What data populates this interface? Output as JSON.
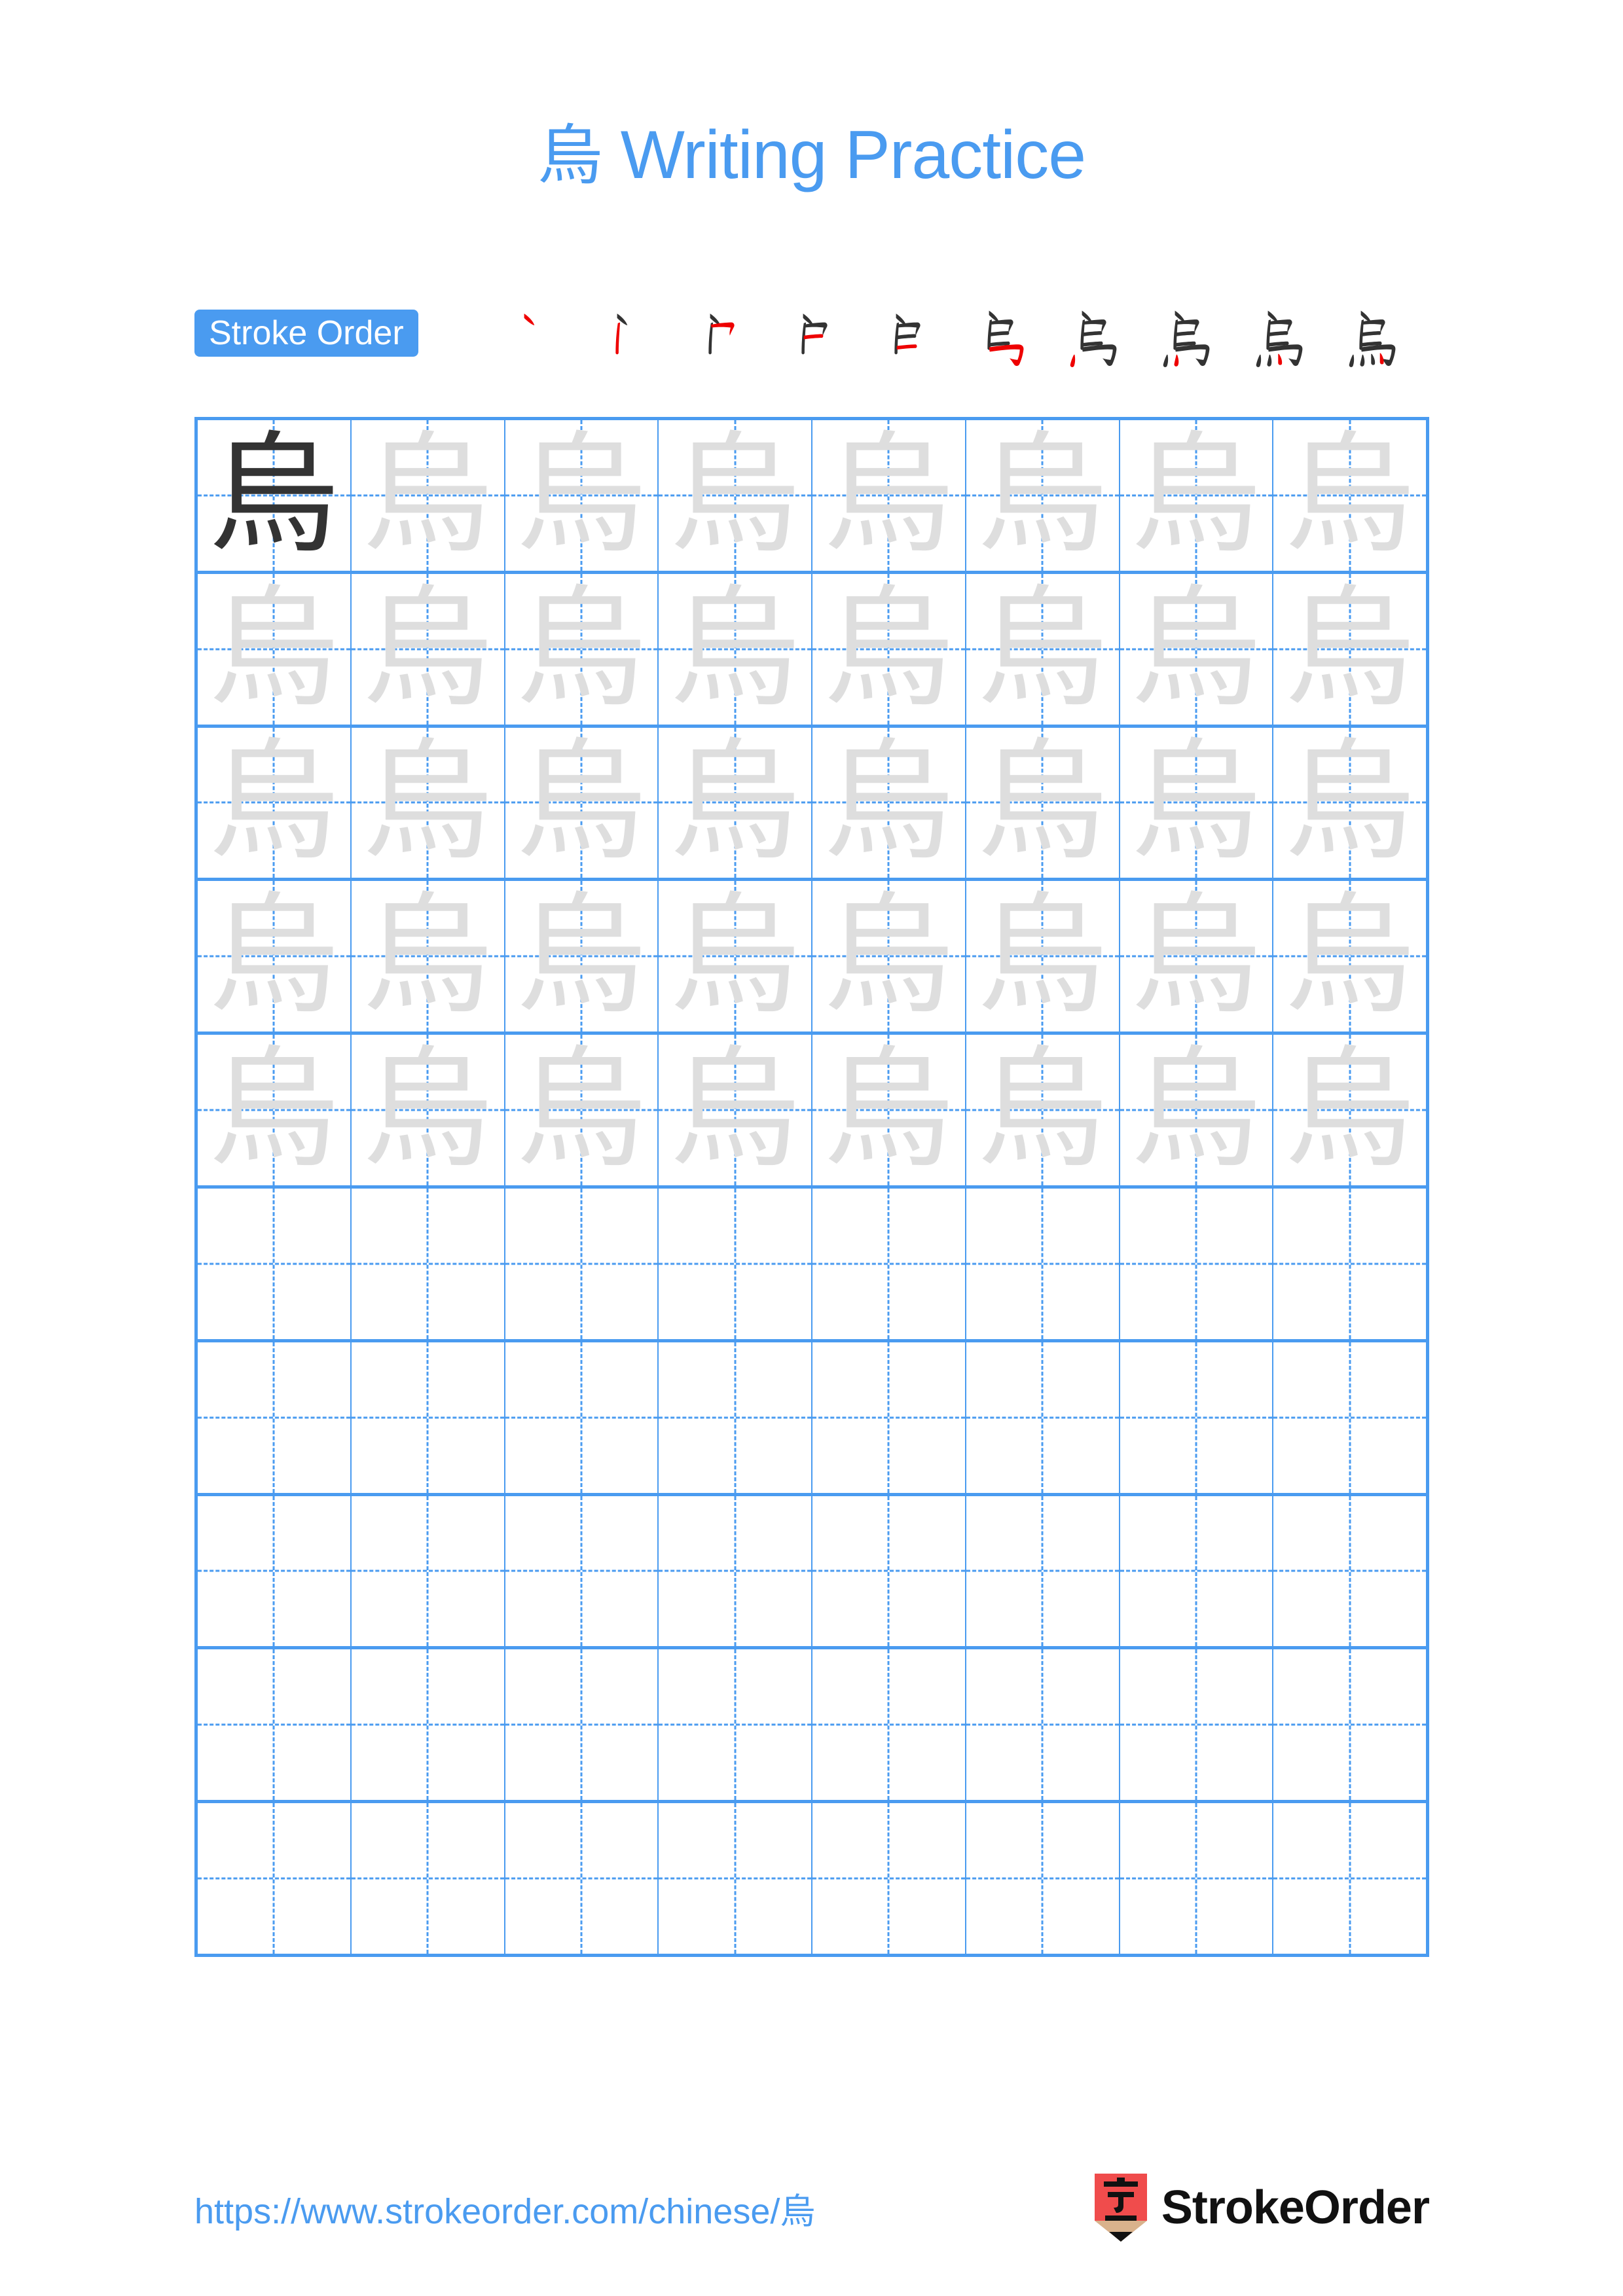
{
  "page": {
    "background_color": "#ffffff",
    "accent_color": "#4a9bf0",
    "character": "烏"
  },
  "header": {
    "title_char": "烏",
    "title_text": " Writing Practice",
    "title_color": "#4a9bf0"
  },
  "stroke_order": {
    "badge_label": "Stroke Order",
    "badge_bg": "#4a9bf0",
    "badge_text_color": "#ffffff",
    "new_stroke_color": "#ee0000",
    "prior_stroke_color": "#333333",
    "total_strokes": 10,
    "steps": [
      {
        "index": 1,
        "strokes_shown": 1,
        "label": "stroke-step-1"
      },
      {
        "index": 2,
        "strokes_shown": 2,
        "label": "stroke-step-2"
      },
      {
        "index": 3,
        "strokes_shown": 3,
        "label": "stroke-step-3"
      },
      {
        "index": 4,
        "strokes_shown": 4,
        "label": "stroke-step-4"
      },
      {
        "index": 5,
        "strokes_shown": 5,
        "label": "stroke-step-5"
      },
      {
        "index": 6,
        "strokes_shown": 6,
        "label": "stroke-step-6"
      },
      {
        "index": 7,
        "strokes_shown": 7,
        "label": "stroke-step-7"
      },
      {
        "index": 8,
        "strokes_shown": 8,
        "label": "stroke-step-8"
      },
      {
        "index": 9,
        "strokes_shown": 9,
        "label": "stroke-step-9"
      },
      {
        "index": 10,
        "strokes_shown": 10,
        "label": "stroke-step-10"
      }
    ]
  },
  "grid": {
    "rows": 10,
    "columns": 8,
    "line_color": "#4a9bf0",
    "traced_char_color": "#dedede",
    "model_char_color": "#333333",
    "cells": [
      [
        "烏",
        "烏",
        "烏",
        "烏",
        "烏",
        "烏",
        "烏",
        "烏"
      ],
      [
        "烏",
        "烏",
        "烏",
        "烏",
        "烏",
        "烏",
        "烏",
        "烏"
      ],
      [
        "烏",
        "烏",
        "烏",
        "烏",
        "烏",
        "烏",
        "烏",
        "烏"
      ],
      [
        "烏",
        "烏",
        "烏",
        "烏",
        "烏",
        "烏",
        "烏",
        "烏"
      ],
      [
        "烏",
        "烏",
        "烏",
        "烏",
        "烏",
        "烏",
        "烏",
        "烏"
      ],
      [
        "",
        "",
        "",
        "",
        "",
        "",
        "",
        ""
      ],
      [
        "",
        "",
        "",
        "",
        "",
        "",
        "",
        ""
      ],
      [
        "",
        "",
        "",
        "",
        "",
        "",
        "",
        ""
      ],
      [
        "",
        "",
        "",
        "",
        "",
        "",
        "",
        ""
      ],
      [
        "",
        "",
        "",
        "",
        "",
        "",
        "",
        ""
      ]
    ],
    "model_cell": {
      "row": 0,
      "column": 0
    }
  },
  "footer": {
    "url": "https://www.strokeorder.com/chinese/烏",
    "url_color": "#4a9bf0",
    "logo_char": "字",
    "logo_wordmark": "StrokeOrder",
    "logo_body_color": "#f04c4c",
    "logo_tip_color": "#d9b28c",
    "logo_point_color": "#111111"
  }
}
